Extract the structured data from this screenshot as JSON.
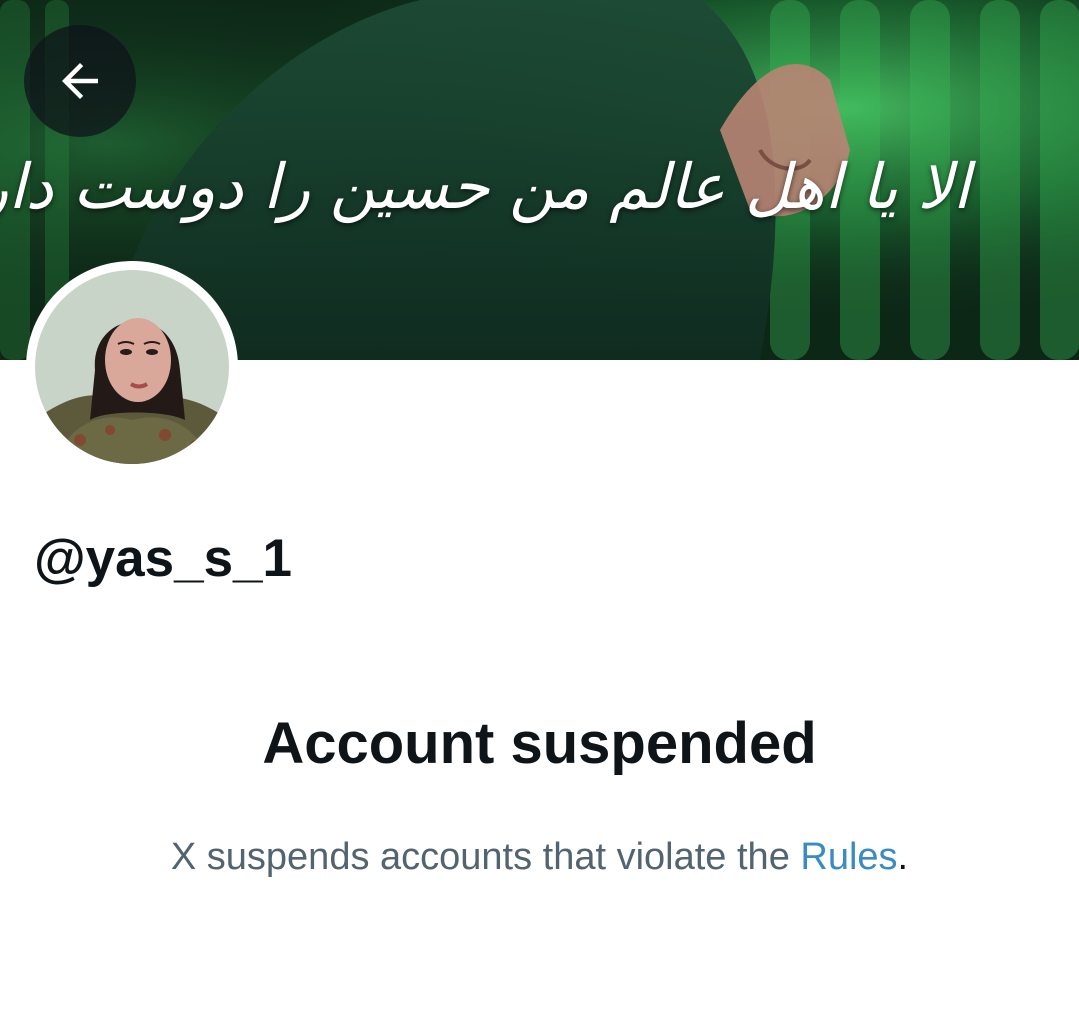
{
  "banner": {
    "caption": "الا یا اهل عالم من حسین را دوست دارم"
  },
  "back_button": {
    "icon": "arrow-left-icon"
  },
  "profile": {
    "avatar_icon": "avatar",
    "handle": "@yas_s_1"
  },
  "suspension": {
    "heading": "Account suspended",
    "message_prefix": "X suspends accounts that violate the ",
    "link_label": "Rules",
    "message_suffix": "."
  },
  "colors": {
    "text_primary": "#0f1419",
    "text_secondary": "#536471",
    "link": "#3a8bc2",
    "banner_green": "#1f6b3a"
  }
}
